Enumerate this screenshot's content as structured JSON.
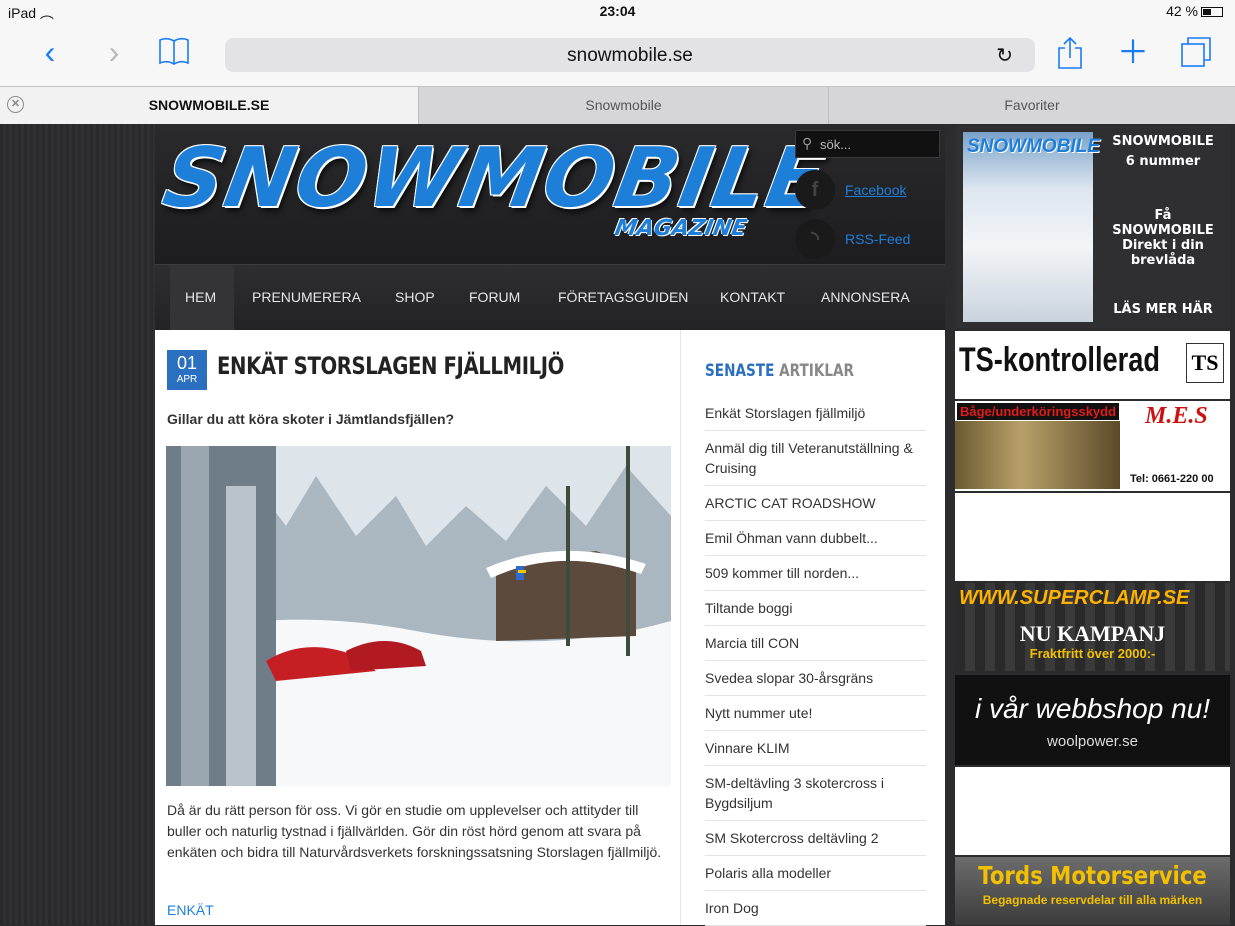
{
  "status": {
    "device": "iPad",
    "time": "23:04",
    "battery": "42 %"
  },
  "browser": {
    "url": "snowmobile.se"
  },
  "tabs": [
    "SNOWMOBILE.SE",
    "Snowmobile",
    "Favoriter"
  ],
  "header": {
    "logo": "SNOWMOBILE",
    "logo_sub": "MAGAZINE",
    "search_placeholder": "sök...",
    "facebook": "Facebook",
    "rss": "RSS-Feed"
  },
  "nav": [
    "HEM",
    "PRENUMERERA",
    "SHOP",
    "FORUM",
    "FÖRETAGSGUIDEN",
    "KONTAKT",
    "ANNONSERA"
  ],
  "article": {
    "day": "01",
    "month": "APR",
    "title": "ENKÄT STORSLAGEN FJÄLLMILJÖ",
    "lede": "Gillar du att köra skoter i Jämtlandsfjällen?",
    "body": "Då är du rätt person för oss. Vi gör en studie om upplevelser och attityder till buller och naturlig tystnad i fjällvärlden. Gör din röst hörd genom att svara på enkäten och bidra till Naturvårdsverkets forskningssatsning Storslagen fjällmiljö.",
    "tag": "ENKÄT"
  },
  "sidebar": {
    "title_a": "SENASTE",
    "title_b": "ARTIKLAR",
    "items": [
      "Enkät Storslagen fjällmiljö",
      "Anmäl dig till Veteranutställning & Cruising",
      "ARCTIC CAT ROADSHOW",
      "Emil Öhman vann dubbelt...",
      "509 kommer till norden...",
      "Tiltande boggi",
      "Marcia till CON",
      "Svedea slopar 30-årsgräns",
      "Nytt nummer ute!",
      "Vinnare KLIM",
      "SM-deltävling 3 skotercross i Bygdsiljum",
      "SM Skotercross deltävling 2",
      "Polaris alla modeller",
      "Iron Dog"
    ]
  },
  "ads": {
    "mag_title": "SNOWMOBILE",
    "mag_line1": "SNOWMOBILE",
    "mag_line2": "6 nummer",
    "mag_line3": "Få SNOWMOBILE Direkt i din brevlåda",
    "mag_cta": "LÄS MER HÄR",
    "ts": "TS-kontrollerad",
    "ts_logo": "TS",
    "mes_top": "Båge/underköringsskydd",
    "mes_logo": "M.E.S",
    "mes_tel": "Tel: 0661-220 00",
    "superclamp": "WWW.SUPERCLAMP.SE",
    "superclamp_2": "NU KAMPANJ",
    "superclamp_3": "Fraktfritt över 2000:-",
    "woolpower_1": "i vår webbshop nu!",
    "woolpower_2": "woolpower.se",
    "tords_1": "Tords Motorservice",
    "tords_2": "Begagnade reservdelar till alla märken"
  }
}
